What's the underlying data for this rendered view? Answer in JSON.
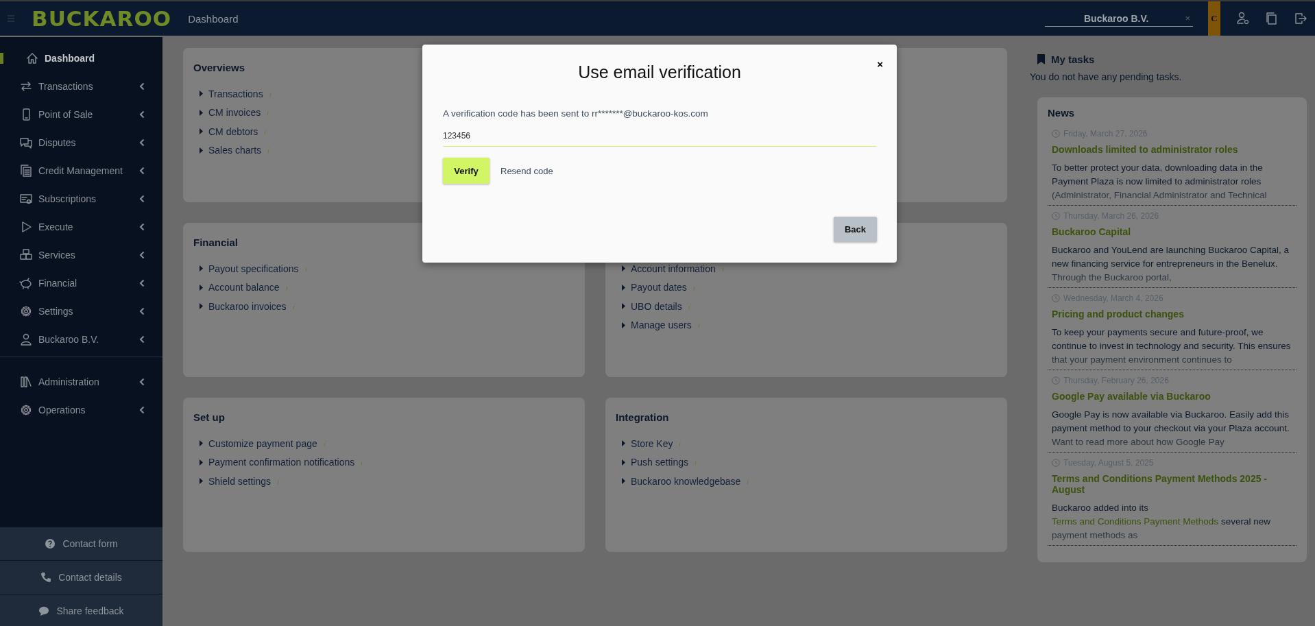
{
  "top_bar": {
    "logo": "BUCKAROO",
    "page_title": "Dashboard",
    "company_select": {
      "value": "Buckaroo B.V.",
      "clear": "×"
    },
    "badge": "C"
  },
  "sidebar": {
    "items": [
      {
        "label": "Dashboard",
        "selected": true,
        "expandable": false
      },
      {
        "label": "Transactions",
        "selected": false,
        "expandable": true
      },
      {
        "label": "Point of Sale",
        "selected": false,
        "expandable": true
      },
      {
        "label": "Disputes",
        "selected": false,
        "expandable": true
      },
      {
        "label": "Credit Management",
        "selected": false,
        "expandable": true
      },
      {
        "label": "Subscriptions",
        "selected": false,
        "expandable": true
      },
      {
        "label": "Execute",
        "selected": false,
        "expandable": true
      },
      {
        "label": "Services",
        "selected": false,
        "expandable": true
      },
      {
        "label": "Financial",
        "selected": false,
        "expandable": true
      },
      {
        "label": "Settings",
        "selected": false,
        "expandable": true
      },
      {
        "label": "Buckaroo B.V.",
        "selected": false,
        "expandable": true
      }
    ],
    "admin_items": [
      {
        "label": "Administration",
        "selected": false,
        "expandable": true
      },
      {
        "label": "Operations",
        "selected": false,
        "expandable": true
      }
    ],
    "footer_links": [
      "Contact form",
      "Contact details",
      "Share feedback"
    ]
  },
  "cards": [
    {
      "kind": "links",
      "title": "Overviews",
      "links": [
        "Transactions",
        "CM invoices",
        "CM debtors",
        "Sales charts"
      ]
    },
    {
      "kind": "blank"
    },
    {
      "title": "Financial",
      "links": [
        "Payout specifications",
        "Account balance",
        "Buckaroo invoices"
      ]
    },
    {
      "links": [
        "Account information",
        "Payout dates",
        "UBO details",
        "Manage users"
      ]
    },
    {
      "title": "Set up",
      "links": [
        "Customize payment page",
        "Payment confirmation notifications",
        "Shield settings"
      ]
    },
    {
      "title": "Integration",
      "links": [
        "Store Key",
        "Push settings",
        "Buckaroo knowledgebase"
      ]
    }
  ],
  "tasks": {
    "title": "My tasks",
    "text": "You do not have any pending tasks."
  },
  "news": {
    "title": "News",
    "items": [
      {
        "date": "Friday, March 27, 2026",
        "title": "Downloads limited to administrator roles",
        "body": [
          {
            "kind": "text",
            "text": "To better protect your data, downloading data in the Payment Plaza is now limited to administrator roles (Administrator, Financial Administrator and Technical"
          }
        ]
      },
      {
        "date": "Thursday, March 26, 2026",
        "title": "Buckaroo Capital",
        "body": [
          {
            "kind": "text",
            "text": "Buckaroo and YouLend are launching Buckaroo Capital, a new financing service for entrepreneurs in the Benelux. Through the Buckaroo portal,"
          }
        ]
      },
      {
        "date": "Wednesday, March 4, 2026",
        "title": "Pricing and product changes",
        "body": [
          {
            "kind": "text",
            "text": "To keep your payments secure and future-proof, we continue to invest in technology and security. This ensures that your payment environment continues to"
          }
        ]
      },
      {
        "date": "Thursday, February 26, 2026",
        "title": "Google Pay available via Buckaroo",
        "body": [
          {
            "kind": "text",
            "text": "Google Pay is now available via Buckaroo. Easily add this payment method to your checkout via your Plaza account. Want to read more about how Google Pay"
          }
        ]
      },
      {
        "date": "Tuesday, August 5, 2025",
        "title": "Terms and Conditions Payment Methods 2025 - August",
        "body": [
          {
            "kind": "text",
            "text": "Buckaroo added into its "
          },
          {
            "kind": "link",
            "text": "Terms and Conditions Payment Methods"
          },
          {
            "kind": "text",
            "text": " several new payment methods as"
          }
        ]
      }
    ]
  },
  "modal": {
    "title": "Use email verification",
    "close": "×",
    "message": "A verification code has been sent to rr*******@buckaroo-kos.com",
    "code": "123456",
    "verify": "Verify",
    "resend": "Resend code",
    "back": "Back"
  }
}
